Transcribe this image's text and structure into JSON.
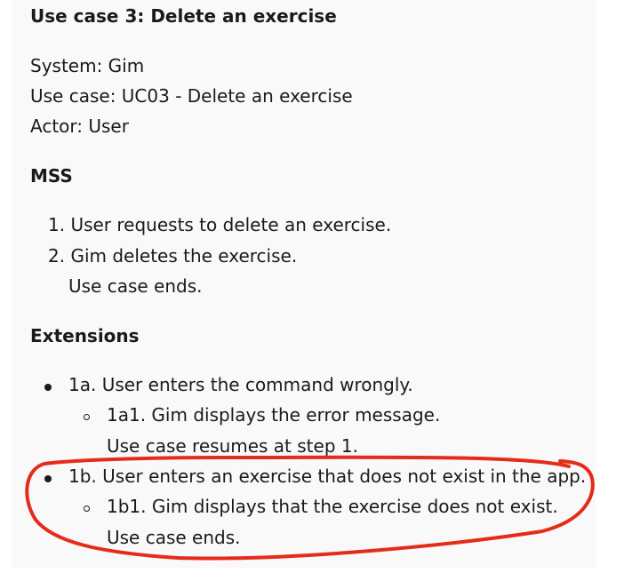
{
  "title": "Use case 3: Delete an exercise",
  "meta": {
    "system": "System: Gim",
    "use_case": "Use case: UC03 - Delete an exercise",
    "actor": "Actor: User"
  },
  "mss": {
    "heading": "MSS",
    "steps": [
      "1. User requests to delete an exercise.",
      "2. Gim deletes the exercise."
    ],
    "end": "Use case ends."
  },
  "extensions": {
    "heading": "Extensions",
    "items": [
      {
        "text": "1a. User enters the command wrongly.",
        "sub": "1a1. Gim displays the error message.",
        "end": "Use case resumes at step 1."
      },
      {
        "text": "1b. User enters an exercise that does not exist in the app.",
        "sub": "1b1. Gim displays that the exercise does not exist.",
        "end": "Use case ends."
      }
    ]
  },
  "annotation_color": "#e52b1a"
}
